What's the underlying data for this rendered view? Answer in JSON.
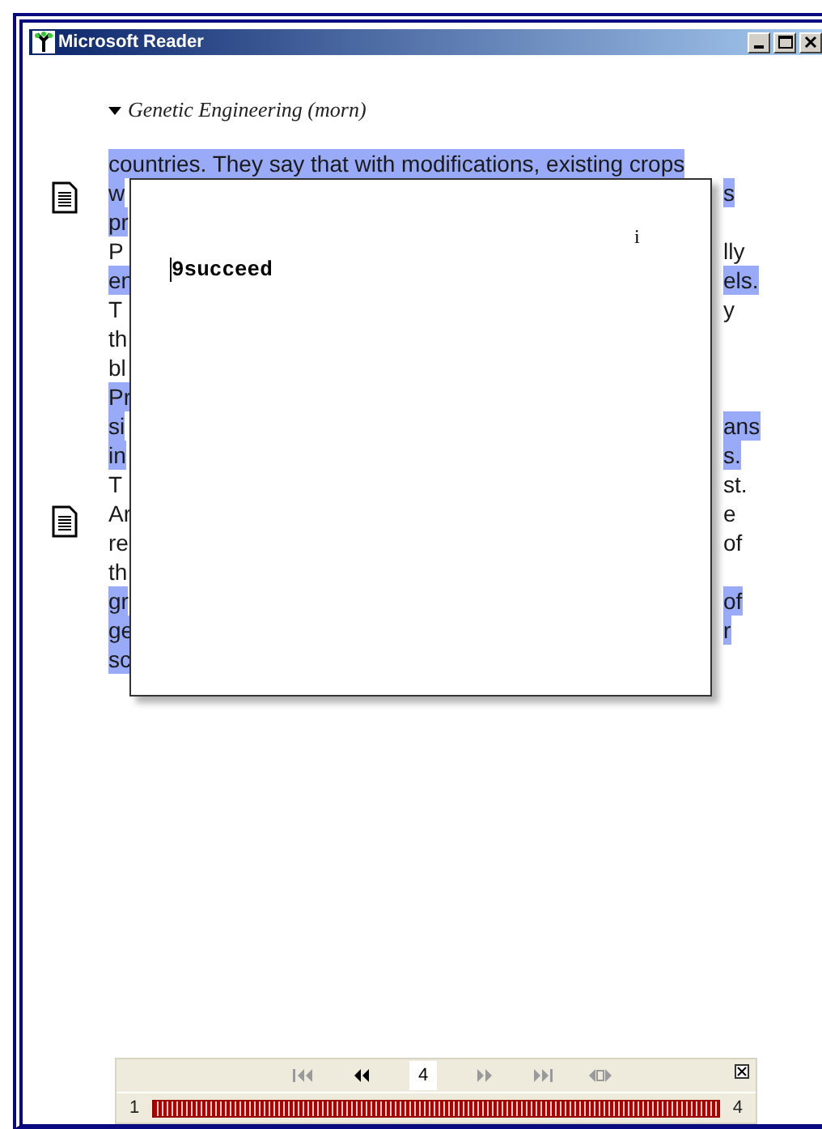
{
  "window": {
    "title": "Microsoft Reader"
  },
  "chapter": {
    "title": "Genetic Engineering (morn)"
  },
  "lines": [
    {
      "left": "countries. They say that with modifications, existing crops",
      "highlighted": true
    },
    {
      "left": "w",
      "right": "s",
      "highlighted": true
    },
    {
      "left": "pr",
      "highlighted": true
    },
    {
      "left": "P",
      "right": "lly",
      "highlighted": false
    },
    {
      "left": "en",
      "right": "els.",
      "highlighted": true
    },
    {
      "left": "T",
      "right": "y",
      "highlighted": false
    },
    {
      "left": "th",
      "highlighted": false
    },
    {
      "left": "bl",
      "highlighted": false
    },
    {
      "left": "Pr",
      "highlighted": true
    },
    {
      "left": "si",
      "right": "ans",
      "highlighted": true
    },
    {
      "left": "in",
      "right": "s.",
      "highlighted": true
    },
    {
      "left": "T",
      "right": "st.",
      "highlighted": false
    },
    {
      "left": "Ar",
      "right": "e",
      "highlighted": false
    },
    {
      "left": "re",
      "right": "of",
      "highlighted": false
    },
    {
      "left": "th",
      "highlighted": false
    },
    {
      "left": "gr",
      "right": "of",
      "highlighted": true
    },
    {
      "left": "ge",
      "right": "r",
      "highlighted": true
    },
    {
      "left": "sc",
      "highlighted": true
    }
  ],
  "popup": {
    "mark": "i",
    "value": "9succeed"
  },
  "nav": {
    "buttons": [
      {
        "kind": "first",
        "disabled": true
      },
      {
        "kind": "prev",
        "disabled": false
      },
      {
        "kind": "page"
      },
      {
        "kind": "next",
        "disabled": true
      },
      {
        "kind": "last",
        "disabled": true
      },
      {
        "kind": "fit",
        "disabled": true
      }
    ],
    "page": "4",
    "first_page": "1",
    "last_page": "4"
  }
}
